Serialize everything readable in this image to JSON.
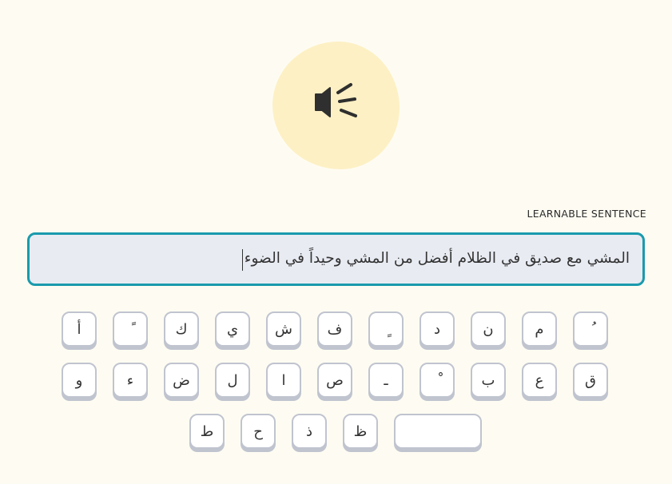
{
  "speaker": {
    "icon": "speaker-icon"
  },
  "sentence": {
    "label": "LEARNABLE SENTENCE",
    "answer_text": "المشي مع صديق في الظلام أفضل من المشي وحيداً في الضوء"
  },
  "keyboard": {
    "row1": [
      "ُ",
      "م",
      "ن",
      "د",
      "ٍ",
      "ف",
      "ش",
      "ي",
      "ك",
      "ً",
      "أ"
    ],
    "row2": [
      "ق",
      "ع",
      "ب",
      "ْ",
      "ـ",
      "ص",
      "ا",
      "ل",
      "ض",
      "ء",
      "و"
    ],
    "row3": [
      "",
      "ظ",
      "ذ",
      "ح",
      "ط"
    ]
  },
  "colors": {
    "background": "#fefcf2",
    "speaker_blob": "#fdf0c4",
    "input_border": "#1a9aad",
    "input_background": "#e8ebf2"
  }
}
